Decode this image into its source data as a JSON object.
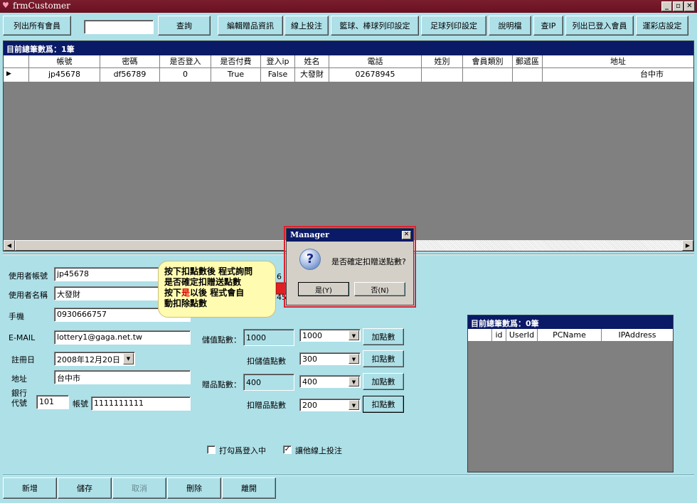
{
  "window": {
    "title": "frmCustomer",
    "min": "_",
    "max": "▫",
    "close": "✕"
  },
  "toolbar": {
    "list_all": "列出所有會員",
    "search_value": "",
    "query": "查詢",
    "edit_gift": "編輯贈品資訊",
    "online_bet": "線上投注",
    "basketball_print": "籃球、棒球列印設定",
    "soccer_print": "足球列印設定",
    "manual": "說明檔",
    "check_ip": "查IP",
    "list_logged": "列出已登入會員",
    "lottery_settings": "運彩店設定"
  },
  "grid": {
    "caption": "目前總筆數爲：1筆",
    "columns": [
      "帳號",
      "密碼",
      "是否登入",
      "是否付費",
      "登入ip",
      "姓名",
      "電話",
      "姓別",
      "會員類別",
      "郵遞區",
      "地址"
    ],
    "row": [
      "jp45678",
      "df56789",
      "0",
      "True",
      "False",
      "大發財",
      "02678945",
      "",
      "",
      "",
      "台中市"
    ],
    "row_indicator": "▶"
  },
  "form": {
    "account_label": "使用者帳號",
    "account_value": "jp45678",
    "name_label": "使用者名稱",
    "name_value": "大發財",
    "mobile_label": "手機",
    "mobile_value": "0930666757",
    "email_label": "E-MAIL",
    "email_value": "lottery1@gaga.net.tw",
    "register_label": "註冊日",
    "register_value": "2008年12月20日",
    "address_label": "地址",
    "address_value": "台中市",
    "bank_label": "銀行\n代號",
    "bank_value": "101",
    "bank_account_label": "帳號",
    "bank_account_value": "1111111111",
    "partial_right_1": "6",
    "partial_right_2": "45",
    "stored_points_label": "儲值點數：",
    "stored_points_value": "1000",
    "stored_points_combo": "1000",
    "add_points_1": "加點數",
    "deduct_stored_label": "扣儲值點數",
    "deduct_stored_combo": "300",
    "deduct_points_1": "扣點數",
    "gift_points_label": "贈品點數：",
    "gift_points_value": "400",
    "gift_points_combo": "400",
    "add_points_2": "加點數",
    "deduct_gift_label": "扣贈品點數",
    "deduct_gift_combo": "200",
    "deduct_points_2": "扣點數",
    "check_logged_label": "打勾爲登入中",
    "check_online_label": "讓他線上投注",
    "check_online_mark": "✓"
  },
  "grid2": {
    "caption": "目前總筆數爲：0筆",
    "columns": [
      "id",
      "UserId",
      "PCName",
      "IPAddress"
    ]
  },
  "bottom": {
    "new": "新增",
    "save": "儲存",
    "cancel": "取消",
    "delete": "刪除",
    "leave": "離開"
  },
  "callout": {
    "line1": "按下扣點數後 程式詢問",
    "line2": "是否確定扣贈送點數",
    "line3a": "按下",
    "line3b": "是",
    "line3c": "以後 程式會自",
    "line4": "動扣除點數"
  },
  "dialog": {
    "title": "Manager",
    "close": "✕",
    "icon": "?",
    "message": "是否確定扣贈送點數?",
    "yes": "是(Y)",
    "no": "否(N)"
  },
  "colors": {
    "background": "#aee0e8",
    "caption": "#0a1a66",
    "titlebar": "#6a1020",
    "highlight_red": "#e00000",
    "callout": "#fffbb0"
  }
}
